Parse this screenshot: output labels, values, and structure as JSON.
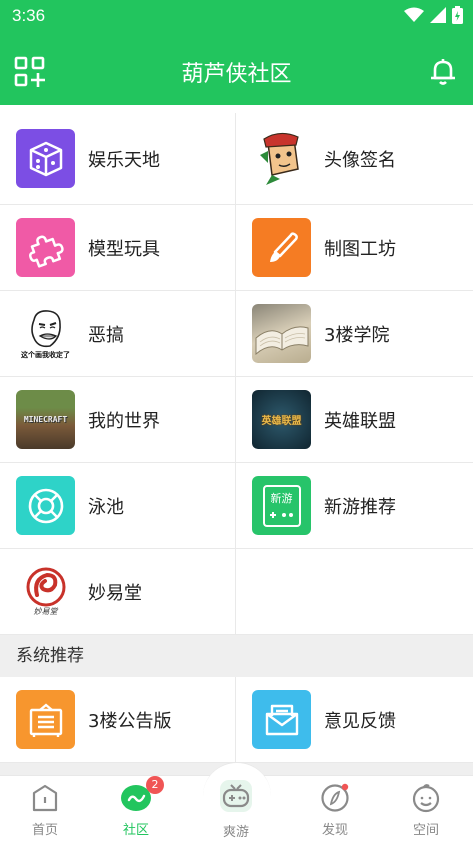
{
  "status_bar": {
    "time": "3:36"
  },
  "header": {
    "title": "葫芦侠社区"
  },
  "categories": [
    {
      "label": "娱乐天地",
      "icon": "dice-icon",
      "color": "#7c4ee4"
    },
    {
      "label": "头像签名",
      "icon": "cartoon-avatar-icon",
      "color": "#ffffff"
    },
    {
      "label": "模型玩具",
      "icon": "puzzle-icon",
      "color": "#f05aa6"
    },
    {
      "label": "制图工坊",
      "icon": "brush-icon",
      "color": "#f57c23"
    },
    {
      "label": "恶搞",
      "icon": "meme-face-icon",
      "color": "#ffffff",
      "caption": "这个画我收定了"
    },
    {
      "label": "3楼学院",
      "icon": "open-book-icon",
      "color": "#d8c9a8"
    },
    {
      "label": "我的世界",
      "icon": "minecraft-logo-icon",
      "color": "#5a6b3a",
      "caption": "MINECRAFT"
    },
    {
      "label": "英雄联盟",
      "icon": "lol-logo-icon",
      "color": "#1e3f4f",
      "caption": "英雄联盟"
    },
    {
      "label": "泳池",
      "icon": "lifebuoy-icon",
      "color": "#2ed3c8"
    },
    {
      "label": "新游推荐",
      "icon": "new-game-icon",
      "color": "#27c46a",
      "caption": "新游"
    },
    {
      "label": "妙易堂",
      "icon": "miaoyitang-logo-icon",
      "color": "#ffffff",
      "caption": "妙易堂"
    }
  ],
  "system_section": {
    "title": "系统推荐",
    "items": [
      {
        "label": "3楼公告版",
        "icon": "notice-board-icon",
        "color": "#f7962e"
      },
      {
        "label": "意见反馈",
        "icon": "mail-icon",
        "color": "#3ebcec"
      }
    ]
  },
  "bottom_nav": [
    {
      "label": "首页",
      "icon": "home-icon",
      "active": false
    },
    {
      "label": "社区",
      "icon": "community-icon",
      "active": true,
      "badge": "2"
    },
    {
      "label": "爽游",
      "icon": "gamepad-icon",
      "active": false
    },
    {
      "label": "发现",
      "icon": "compass-icon",
      "active": false
    },
    {
      "label": "空间",
      "icon": "profile-face-icon",
      "active": false
    }
  ],
  "colors": {
    "brand": "#22c55e",
    "badge": "#f05555"
  }
}
